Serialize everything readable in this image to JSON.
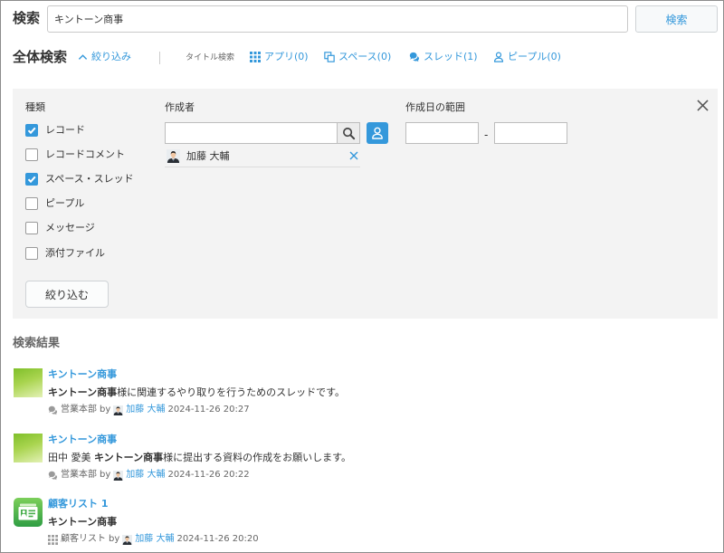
{
  "theme": {
    "accent": "#3498db",
    "panel_bg": "#f3f3f3",
    "text": "#333333",
    "muted": "#666666"
  },
  "header": {
    "search_label": "検索",
    "search_value": "キントーン商事",
    "search_button": "検索"
  },
  "scope_bar": {
    "title": "全体検索",
    "filter_toggle": {
      "icon": "chevron-up-icon",
      "label": "絞り込み"
    },
    "title_search_label": "タイトル検索",
    "links": [
      {
        "icon": "grid-icon",
        "label": "アプリ(0)"
      },
      {
        "icon": "spaces-icon",
        "label": "スペース(0)"
      },
      {
        "icon": "thread-icon",
        "label": "スレッド(1)"
      },
      {
        "icon": "people-icon",
        "label": "ピープル(0)"
      }
    ]
  },
  "filter": {
    "type_label": "種類",
    "types": [
      {
        "label": "レコード",
        "checked": true
      },
      {
        "label": "レコードコメント",
        "checked": false
      },
      {
        "label": "スペース・スレッド",
        "checked": true
      },
      {
        "label": "ピープル",
        "checked": false
      },
      {
        "label": "メッセージ",
        "checked": false
      },
      {
        "label": "添付ファイル",
        "checked": false
      }
    ],
    "apply_button": "絞り込む",
    "creator": {
      "label": "作成者",
      "input_value": "",
      "selected_users": [
        {
          "name": "加藤 大輔"
        }
      ]
    },
    "date_range": {
      "label": "作成日の範囲",
      "from": "",
      "to": "",
      "separator": "-"
    },
    "close_icon": "close-icon"
  },
  "results_heading": "検索結果",
  "results": [
    {
      "thumbnail": "thread-thumbnail",
      "title": "キントーン商事",
      "snippet": [
        {
          "text": "キントーン商事",
          "bold": true
        },
        {
          "text": "様に関連するやり取りを行うためのスレッドです。",
          "bold": false
        }
      ],
      "location_icon": "thread-icon",
      "location": "営業本部",
      "by": "by",
      "author": "加藤 大輔",
      "datetime": "2024-11-26 20:27"
    },
    {
      "thumbnail": "thread-thumbnail",
      "title": "キントーン商事",
      "snippet": [
        {
          "text": "田中 愛美 ",
          "bold": false
        },
        {
          "text": "キントーン商事",
          "bold": true
        },
        {
          "text": "様に提出する資料の作成をお願いします。",
          "bold": false
        }
      ],
      "location_icon": "thread-icon",
      "location": "営業本部",
      "by": "by",
      "author": "加藤 大輔",
      "datetime": "2024-11-26 20:22"
    },
    {
      "thumbnail": "customer-list-app-icon",
      "title": "顧客リスト 1",
      "snippet": [
        {
          "text": "キントーン商事",
          "bold": true
        }
      ],
      "location_icon": "grid-icon",
      "location": "顧客リスト",
      "by": "by",
      "author": "加藤 大輔",
      "datetime": "2024-11-26 20:20"
    }
  ]
}
